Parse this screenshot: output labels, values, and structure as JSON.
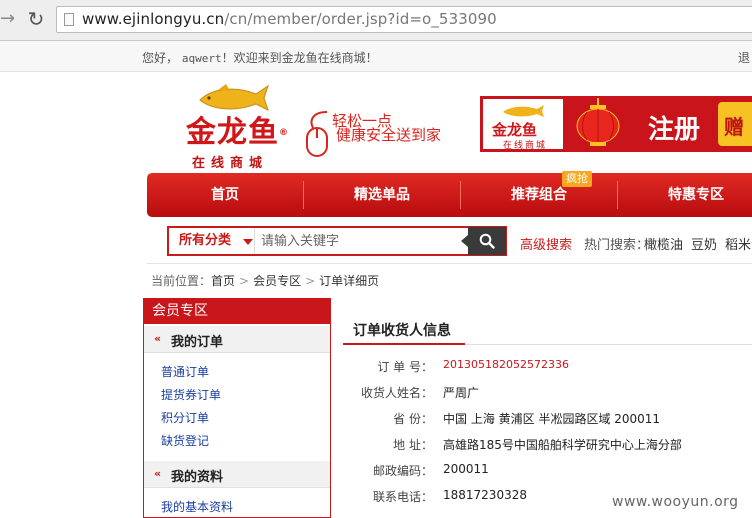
{
  "browser": {
    "url_domain": "www.ejinlongyu.cn",
    "url_path": "/cn/member/order.jsp?id=o_533090"
  },
  "welcome": {
    "greeting": "您好，",
    "username": "aqwert",
    "message": "！欢迎来到金龙鱼在线商城！",
    "right_text": "退"
  },
  "header": {
    "logo_name": "金龙鱼",
    "logo_reg": "®",
    "logo_sub": "在线商城",
    "slogan_line1": "轻松一点",
    "slogan_line2": "健康安全送到家",
    "banner_logo": "金龙鱼",
    "banner_logo_sub": "在线商城",
    "banner_register": "注册",
    "banner_gift": "赠"
  },
  "nav": {
    "items": [
      "首页",
      "精选单品",
      "推荐组合",
      "特惠专区"
    ],
    "hot_tag": "疯抢"
  },
  "search": {
    "category_label": "所有分类",
    "placeholder": "请输入关键字",
    "advanced_label": "高级搜索",
    "hot_label": "热门搜索：",
    "hot_words": [
      "橄榄油",
      "豆奶",
      "稻米油"
    ]
  },
  "breadcrumb": {
    "prefix": "当前位置：",
    "items": [
      "首页",
      "会员专区",
      "订单详细页"
    ],
    "separator": ">"
  },
  "sidebar": {
    "title": "会员专区",
    "groups": [
      {
        "label": "我的订单",
        "links": [
          "普通订单",
          "提货券订单",
          "积分订单",
          "缺货登记"
        ]
      },
      {
        "label": "我的资料",
        "links": [
          "我的基本资料"
        ]
      }
    ],
    "group_icon": "«"
  },
  "order": {
    "section_title": "订单收货人信息",
    "rows": [
      {
        "label": "订 单 号：",
        "value": "201305182052572336"
      },
      {
        "label": "收货人姓名：",
        "value": "严周广"
      },
      {
        "label": "省    份：",
        "value": "中国 上海 黄浦区 半凇园路区域 200011"
      },
      {
        "label": "地    址：",
        "value": "高雄路185号中国船舶科学研究中心上海分部"
      },
      {
        "label": "邮政编码：",
        "value": "200011"
      },
      {
        "label": "联系电话：",
        "value": "18817230328"
      }
    ]
  },
  "watermark": "www.wooyun.org",
  "colors": {
    "brand_red": "#c9161b",
    "nav_red": "#d01e1c",
    "link_blue": "#1a3fa0",
    "hot_tag_orange": "#f6a821"
  },
  "icons": [
    "back-arrow-icon",
    "reload-icon",
    "page-icon",
    "gold-fish-icon",
    "mouse-icon",
    "lantern-icon",
    "search-icon",
    "dropdown-caret-icon",
    "double-chevron-icon"
  ]
}
